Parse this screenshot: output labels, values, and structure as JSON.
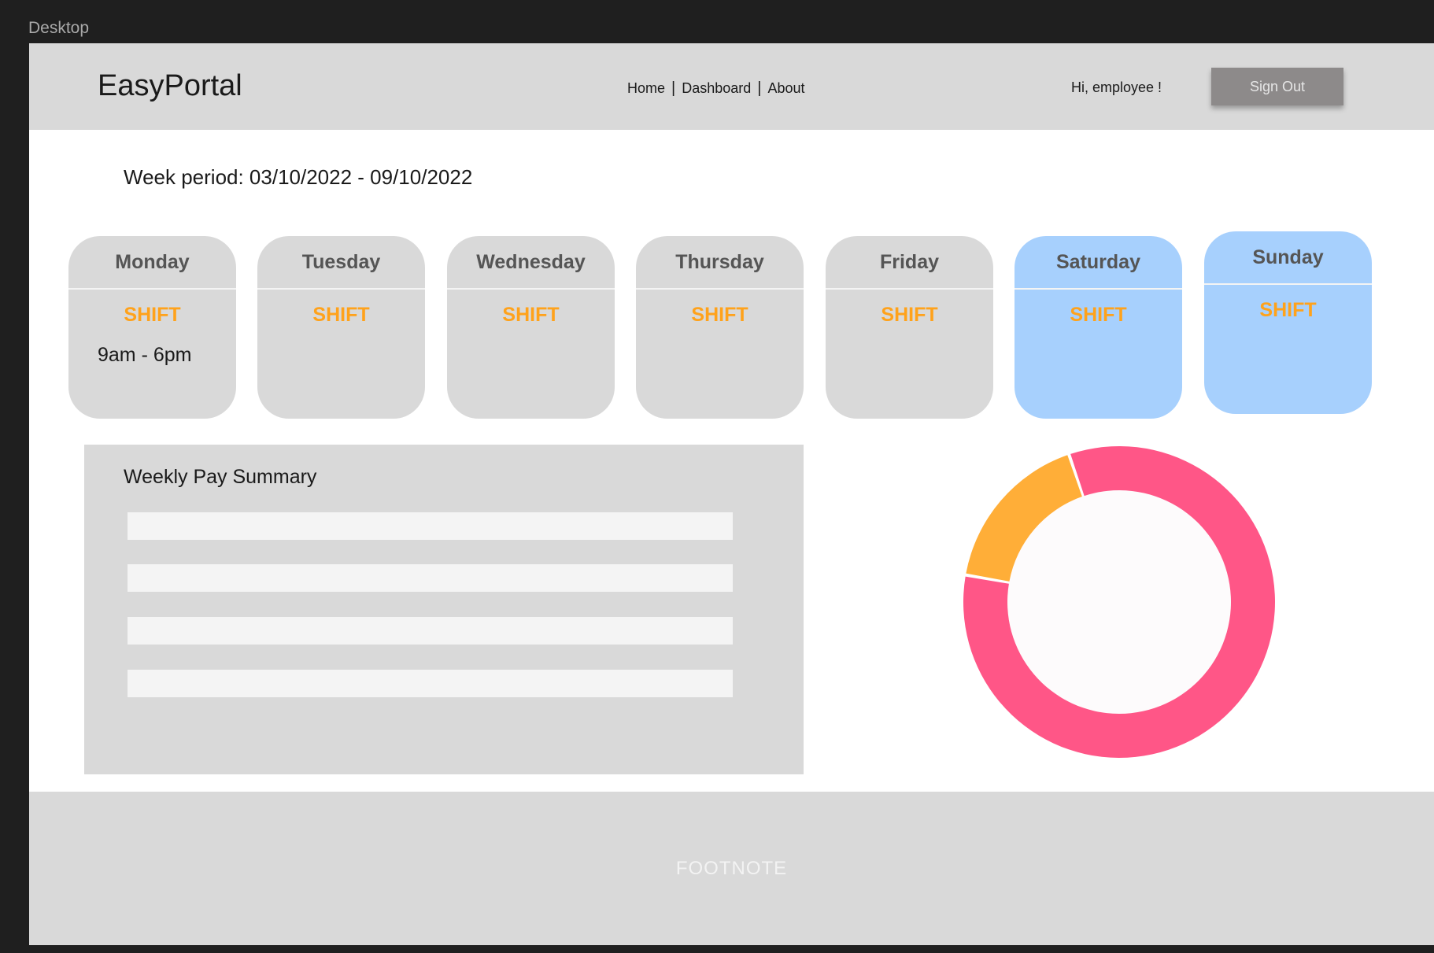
{
  "frame_label": "Desktop",
  "header": {
    "brand": "EasyPortal",
    "nav": [
      "Home",
      "Dashboard",
      "About"
    ],
    "greeting": "Hi, employee !",
    "sign_out": "Sign Out"
  },
  "week_period": "Week period: 03/10/2022 - 09/10/2022",
  "days": [
    {
      "name": "Monday",
      "shift": "SHIFT",
      "time": "9am - 6pm"
    },
    {
      "name": "Tuesday",
      "shift": "SHIFT",
      "time": ""
    },
    {
      "name": "Wednesday",
      "shift": "SHIFT",
      "time": ""
    },
    {
      "name": "Thursday",
      "shift": "SHIFT",
      "time": ""
    },
    {
      "name": "Friday",
      "shift": "SHIFT",
      "time": ""
    },
    {
      "name": "Saturday",
      "shift": "SHIFT",
      "time": ""
    },
    {
      "name": "Sunday",
      "shift": "SHIFT",
      "time": ""
    }
  ],
  "pay_summary": {
    "title": "Weekly Pay Summary",
    "rows": 4
  },
  "donut": {
    "segments": [
      {
        "fraction": 0.17,
        "color": "#ffae38"
      },
      {
        "fraction": 0.83,
        "color": "#ff5687"
      }
    ]
  },
  "footer": {
    "text": "FOOTNOTE"
  },
  "colors": {
    "shift_text": "#ffa21b",
    "weekday_card": "#d9d9d9",
    "weekend_card": "#a7d0fd"
  }
}
